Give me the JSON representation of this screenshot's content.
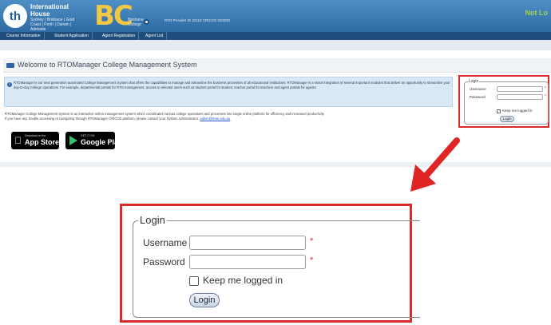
{
  "header": {
    "logo_mark": "th",
    "logo_line1": "International",
    "logo_line2": "House",
    "logo_line3": "Sydney | Brisbane | Gold Coast | Perth | Darwin | Adelaide",
    "bc_letters": "BC",
    "bc_sub": "Brisbane College",
    "tagline": "RTO Provider ID 32110 CRICOS 03430G",
    "right_text": "Not Lo"
  },
  "nav": {
    "items": [
      "Course Information",
      "Student Application",
      "Agent Registration",
      "Agent List"
    ]
  },
  "welcome": {
    "title": "Welcome to RTOManager College Management System"
  },
  "info": {
    "text": "RTOManager is our next generation automated College Management System that offers the capabilities to manage and streamline the business processes of all educational institutions. RTOManager is a smart integration of several important modules that deliver an opportunity to streamline your day-to-day College operations. For example, departmental portals for RTO management, access to relevant users such as student portal for student, teacher portal for teachers and agent portals for agents."
  },
  "desc": {
    "line1": "RTOManager College Management System is an interactive online management system which coordinates various college operations and processes into single online platform for efficiency and increased productivity.",
    "line2": "If you have any trouble accessing or navigating through RTOManager CRICOS platform, please contact your System Administrator.",
    "email": "admin@rtom.edu.au"
  },
  "stores": {
    "appstore_small": "Download on the",
    "appstore_big": "App Store",
    "gplay_small": "GET IT ON",
    "gplay_big": "Google Play"
  },
  "login": {
    "legend": "Login",
    "username_label": "Username",
    "password_label": "Password",
    "username_value": "",
    "password_value": "",
    "required_mark": "*",
    "keep_label": "Keep me logged in",
    "button_label": "Login"
  },
  "colors": {
    "header": "#2e6aa3",
    "highlight": "#d82a2a",
    "bc_gold": "#f2c744"
  }
}
